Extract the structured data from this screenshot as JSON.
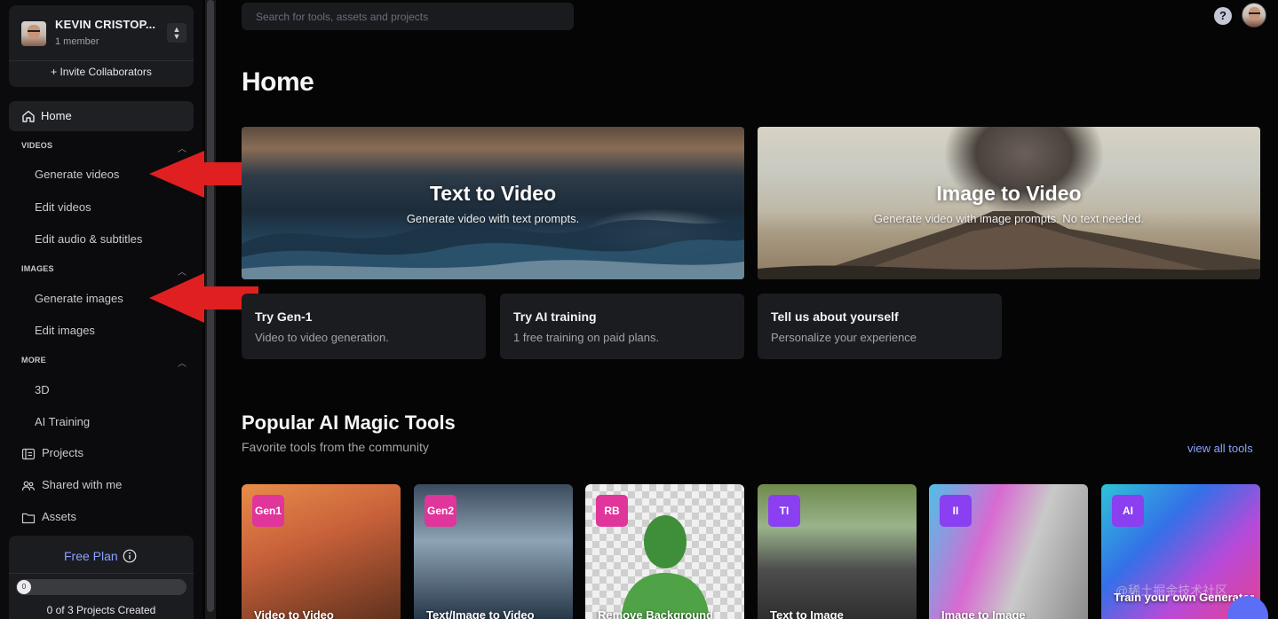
{
  "team": {
    "name": "KEVIN CRISTOP...",
    "members": "1 member",
    "invite_label": "+ Invite Collaborators"
  },
  "sidebar": {
    "home_label": "Home",
    "sections": [
      {
        "title": "VIDEOS",
        "items": [
          "Generate videos",
          "Edit videos",
          "Edit audio & subtitles"
        ]
      },
      {
        "title": "IMAGES",
        "items": [
          "Generate images",
          "Edit images"
        ]
      },
      {
        "title": "MORE",
        "items": [
          "3D",
          "AI Training"
        ]
      }
    ],
    "nav": [
      {
        "label": "Projects",
        "icon": "projects-icon"
      },
      {
        "label": "Shared with me",
        "icon": "shared-icon"
      },
      {
        "label": "Assets",
        "icon": "folder-icon"
      }
    ],
    "plan": {
      "title": "Free Plan",
      "progress_fraction": 0,
      "progress_knob": "0",
      "count_text": "0 of 3 Projects Created"
    }
  },
  "header": {
    "search_placeholder": "Search for tools, assets and projects"
  },
  "main": {
    "title": "Home",
    "heroes": [
      {
        "title": "Text to Video",
        "subtitle": "Generate video with text prompts."
      },
      {
        "title": "Image to Video",
        "subtitle": "Generate video with image prompts. No text needed."
      }
    ],
    "cards": [
      {
        "title": "Try Gen-1",
        "subtitle": "Video to video generation."
      },
      {
        "title": "Try AI training",
        "subtitle": "1 free training on paid plans."
      },
      {
        "title": "Tell us about yourself",
        "subtitle": "Personalize your experience"
      }
    ],
    "tools_section": {
      "title": "Popular AI Magic Tools",
      "subtitle": "Favorite tools from the community",
      "view_all": "view all tools"
    },
    "tools": [
      {
        "badge": "Gen1",
        "name": "Video to Video",
        "badge_color": "#e0359a"
      },
      {
        "badge": "Gen2",
        "name": "Text/Image to Video",
        "badge_color": "#e0359a"
      },
      {
        "badge": "RB",
        "name": "Remove Background",
        "badge_color": "#e0359a"
      },
      {
        "badge": "TI",
        "name": "Text to Image",
        "badge_color": "#8a3ff0"
      },
      {
        "badge": "II",
        "name": "Image to Image",
        "badge_color": "#8a3ff0"
      },
      {
        "badge": "AI",
        "name": "Train your own Generator",
        "badge_color": "#8a3ff0"
      }
    ]
  },
  "watermark": "@稀土掘金技术社区",
  "colors": {
    "accent": "#8aa2ff",
    "arrow": "#e02020",
    "background": "#050505",
    "sidebar": "#0b0b0d",
    "card": "#1b1c20"
  }
}
